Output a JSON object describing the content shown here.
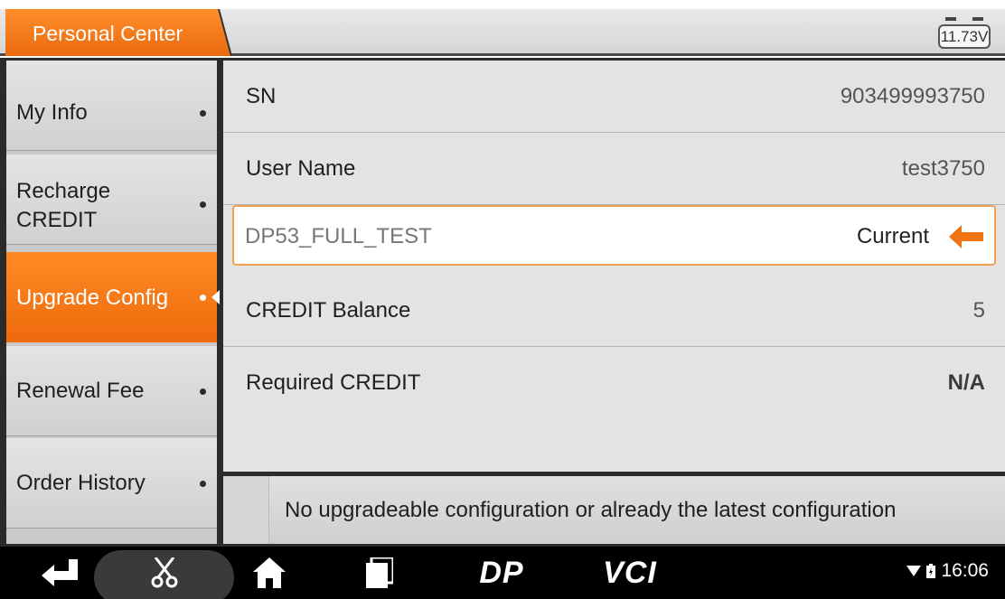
{
  "header": {
    "title": "Personal Center",
    "voltage": "11.73V"
  },
  "sidebar": {
    "items": [
      {
        "label": "My Info",
        "active": false
      },
      {
        "label": "Recharge CREDIT",
        "active": false
      },
      {
        "label": "Upgrade Config",
        "active": true
      },
      {
        "label": "Renewal Fee",
        "active": false
      },
      {
        "label": "Order History",
        "active": false
      }
    ]
  },
  "info": {
    "sn_label": "SN",
    "sn_value": "903499993750",
    "user_label": "User Name",
    "user_value": "test3750",
    "config_name": "DP53_FULL_TEST",
    "config_status": "Current",
    "balance_label": "CREDIT Balance",
    "balance_value": "5",
    "required_label": "Required CREDIT",
    "required_value": "N/A"
  },
  "message": "No upgradeable configuration or already the latest configuration",
  "navbar": {
    "brand_dp": "DP",
    "brand_vci": "VCI",
    "time": "16:06"
  },
  "colors": {
    "accent": "#f07414",
    "panel": "#e3e3e3",
    "navbar": "#000000"
  }
}
